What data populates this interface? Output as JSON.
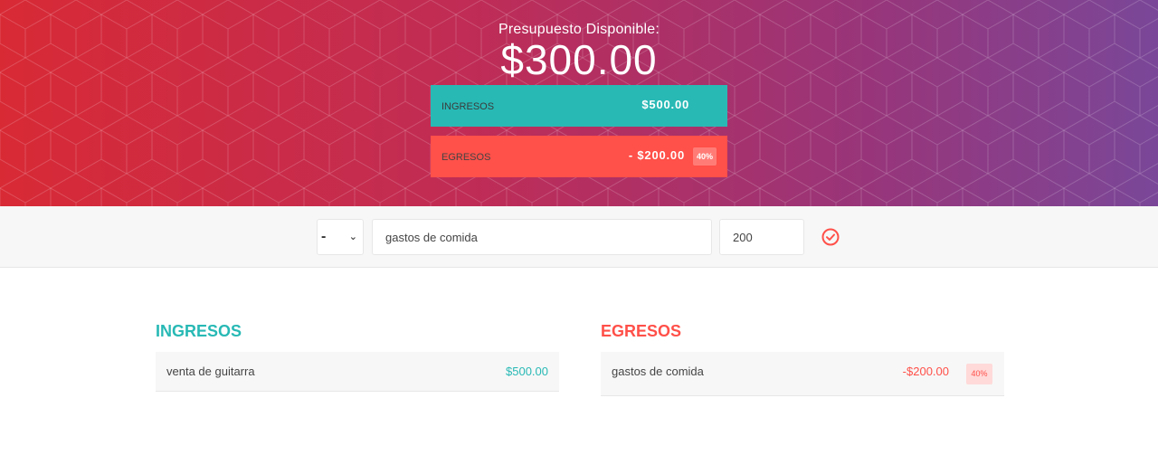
{
  "header": {
    "budget_title": "Presupuesto Disponible:",
    "budget_value": "$300.00",
    "income_label": "INGRESOS",
    "income_value": "$500.00",
    "expense_label": "EGRESOS",
    "expense_value": "- $200.00",
    "expense_percent": "40%"
  },
  "add_form": {
    "type_value": "-",
    "description_value": "gastos de comida",
    "amount_value": "200",
    "submit_icon": "check-circle-icon"
  },
  "income": {
    "title": "INGRESOS",
    "items": [
      {
        "description": "venta de guitarra",
        "value": "$500.00"
      }
    ]
  },
  "expenses": {
    "title": "EGRESOS",
    "items": [
      {
        "description": "gastos de comida",
        "value": "-$200.00",
        "percent": "40%"
      }
    ]
  },
  "colors": {
    "income": "#28b9b5",
    "expense": "#ff5049",
    "gradient_start": "#d82a35",
    "gradient_end": "#7a4798"
  }
}
